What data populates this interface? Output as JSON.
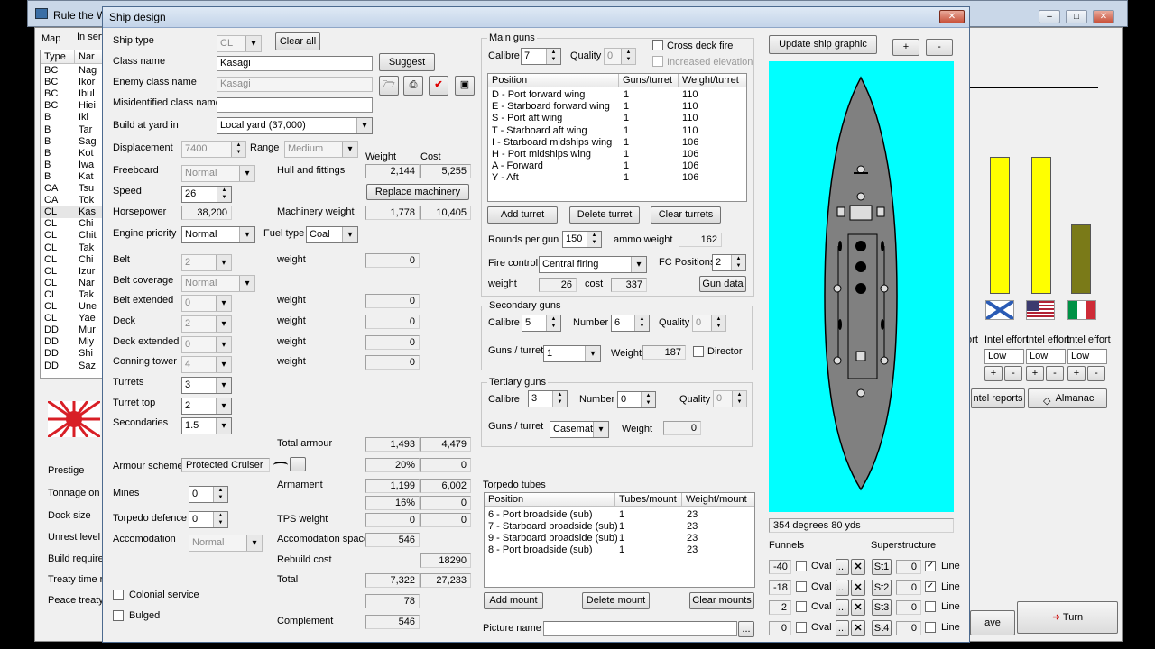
{
  "parent": {
    "title": "Rule the Wa",
    "tabs": [
      "Map",
      "In serv"
    ],
    "list_headers": [
      "Type",
      "Nar"
    ],
    "rows": [
      [
        "BC",
        "Nag"
      ],
      [
        "BC",
        "Ikor"
      ],
      [
        "BC",
        "Ibul"
      ],
      [
        "BC",
        "Hiei"
      ],
      [
        "B",
        "Iki"
      ],
      [
        "B",
        "Tar"
      ],
      [
        "B",
        "Sag"
      ],
      [
        "B",
        "Kot"
      ],
      [
        "B",
        "Iwa"
      ],
      [
        "B",
        "Kat"
      ],
      [
        "CA",
        "Tsu"
      ],
      [
        "CA",
        "Tok"
      ],
      [
        "CL",
        "Kas"
      ],
      [
        "CL",
        "Chi"
      ],
      [
        "CL",
        "Chit"
      ],
      [
        "CL",
        "Tak"
      ],
      [
        "CL",
        "Chi"
      ],
      [
        "CL",
        "Izur"
      ],
      [
        "CL",
        "Nar"
      ],
      [
        "CL",
        "Tak"
      ],
      [
        "CL",
        "Une"
      ],
      [
        "CL",
        "Yae"
      ],
      [
        "DD",
        "Mur"
      ],
      [
        "DD",
        "Miy"
      ],
      [
        "DD",
        "Shi"
      ],
      [
        "DD",
        "Saz"
      ]
    ],
    "left_labels": [
      "Prestige",
      "Tonnage on f",
      "Dock size",
      "Unrest level",
      "Build requiren",
      "Treaty time re",
      "Peace treaty l"
    ],
    "intel_labels": [
      "fort",
      "Intel effort",
      "Intel effort",
      "Intel effort"
    ],
    "intel_values": [
      "Low",
      "Low",
      "Low"
    ],
    "intel_reports": "ntel reports",
    "almanac": "Almanac",
    "save": "ave",
    "turn": "Turn"
  },
  "dialog": {
    "title": "Ship design",
    "ship_type_label": "Ship type",
    "ship_type": "CL",
    "clear_all": "Clear all",
    "class_name_label": "Class name",
    "class_name": "Kasagi",
    "suggest": "Suggest",
    "enemy_class_label": "Enemy class name",
    "enemy_class": "Kasagi",
    "misidentified_label": "Misidentified class name",
    "misidentified": "",
    "build_yard_label": "Build at yard in",
    "build_yard": "Local yard (37,000)",
    "displacement_label": "Displacement",
    "displacement": "7400",
    "range_label": "Range",
    "range": "Medium",
    "weight_hdr": "Weight",
    "cost_hdr": "Cost",
    "freeboard_label": "Freeboard",
    "freeboard": "Normal",
    "hull_label": "Hull and fittings",
    "hull_weight": "2,144",
    "hull_cost": "5,255",
    "speed_label": "Speed",
    "speed": "26",
    "replace_machinery": "Replace machinery",
    "horsepower_label": "Horsepower",
    "horsepower": "38,200",
    "machinery_label": "Machinery weight",
    "mach_weight": "1,778",
    "mach_cost": "10,405",
    "engine_label": "Engine priority",
    "engine": "Normal",
    "fuel_label": "Fuel type",
    "fuel": "Coal",
    "belt_label": "Belt",
    "belt": "2",
    "weight_lbl": "weight",
    "belt_weight": "0",
    "belt_cov_label": "Belt coverage",
    "belt_cov": "Normal",
    "belt_ext_label": "Belt extended",
    "belt_ext": "0",
    "belt_ext_weight": "0",
    "deck_label": "Deck",
    "deck": "2",
    "deck_weight": "0",
    "deck_ext_label": "Deck extended",
    "deck_ext": "0",
    "deck_ext_weight": "0",
    "conning_label": "Conning tower",
    "conning": "4",
    "conning_weight": "0",
    "turrets_label": "Turrets",
    "turrets": "3",
    "turret_top_label": "Turret top",
    "turret_top": "2",
    "secondaries_label": "Secondaries",
    "secondaries": "1.5",
    "total_armour_label": "Total armour",
    "total_armour_weight": "1,493",
    "total_armour_cost": "4,479",
    "armour_scheme_label": "Armour scheme",
    "armour_scheme": "Protected Cruiser",
    "armour_pct": "20%",
    "armour_pct_cost": "0",
    "armament_label": "Armament",
    "armament_weight": "1,199",
    "armament_cost": "6,002",
    "armament_pct": "16%",
    "armament_pct_cost": "0",
    "mines_label": "Mines",
    "mines": "0",
    "torp_def_label": "Torpedo defence",
    "torp_def": "0",
    "tps_label": "TPS weight",
    "tps_weight": "0",
    "tps_cost": "0",
    "accom_label": "Accomodation",
    "accom": "Normal",
    "accom_space_label": "Accomodation space",
    "accom_space": "546",
    "rebuild_label": "Rebuild cost",
    "rebuild": "18290",
    "total_label": "Total",
    "total_weight": "7,322",
    "total_cost": "27,233",
    "colonial_label": "Colonial service",
    "unknown_val": "78",
    "bulged_label": "Bulged",
    "complement_label": "Complement",
    "complement": "546",
    "main_guns": {
      "title": "Main guns",
      "calibre_label": "Calibre",
      "calibre": "7",
      "quality_label": "Quality",
      "quality": "0",
      "cross_deck": "Cross deck fire",
      "increased_elev": "Increased elevation",
      "headers": [
        "Position",
        "Guns/turret",
        "Weight/turret"
      ],
      "rows": [
        [
          "D - Port forward wing",
          "1",
          "110"
        ],
        [
          "E - Starboard forward wing",
          "1",
          "110"
        ],
        [
          "S - Port aft wing",
          "1",
          "110"
        ],
        [
          "T - Starboard aft wing",
          "1",
          "110"
        ],
        [
          "I - Starboard midships wing",
          "1",
          "106"
        ],
        [
          "H - Port midships wing",
          "1",
          "106"
        ],
        [
          "A - Forward",
          "1",
          "106"
        ],
        [
          "Y - Aft",
          "1",
          "106"
        ]
      ],
      "add_turret": "Add turret",
      "delete_turret": "Delete turret",
      "clear_turrets": "Clear turrets",
      "rounds_label": "Rounds per gun",
      "rounds": "150",
      "ammo_label": "ammo weight",
      "ammo": "162",
      "fire_control_label": "Fire control",
      "fire_control": "Central firing",
      "fc_positions_label": "FC Positions",
      "fc_positions": "2",
      "weight_label": "weight",
      "weight": "26",
      "cost_label": "cost",
      "cost": "337",
      "gun_data": "Gun data"
    },
    "secondary": {
      "title": "Secondary guns",
      "calibre_label": "Calibre",
      "calibre": "5",
      "number_label": "Number",
      "number": "6",
      "quality_label": "Quality",
      "quality": "0",
      "gpt_label": "Guns / turret",
      "gpt": "1",
      "weight_label": "Weight",
      "weight": "187",
      "director": "Director"
    },
    "tertiary": {
      "title": "Tertiary guns",
      "calibre_label": "Calibre",
      "calibre": "3",
      "number_label": "Number",
      "number": "0",
      "quality_label": "Quality",
      "quality": "0",
      "gpt_label": "Guns / turret",
      "gpt": "Casemate",
      "weight_label": "Weight",
      "weight": "0"
    },
    "torpedo": {
      "title": "Torpedo tubes",
      "headers": [
        "Position",
        "Tubes/mount",
        "Weight/mount"
      ],
      "rows": [
        [
          "6 - Port broadside (sub)",
          "1",
          "23"
        ],
        [
          "7 - Starboard broadside (sub)",
          "1",
          "23"
        ],
        [
          "9 - Starboard broadside (sub)",
          "1",
          "23"
        ],
        [
          "8 - Port broadside (sub)",
          "1",
          "23"
        ]
      ],
      "add_mount": "Add mount",
      "delete_mount": "Delete mount",
      "clear_mounts": "Clear mounts"
    },
    "picture_label": "Picture name",
    "picture": "",
    "browse": "...",
    "update_graphic": "Update ship graphic",
    "zoom_in": "+",
    "zoom_out": "-",
    "bearing": "354 degrees 80 yds",
    "funnels_label": "Funnels",
    "superstructure_label": "Superstructure",
    "funnels": [
      {
        "pos": "-40",
        "oval": "Oval",
        "st": "St1",
        "sv": "0",
        "line": true
      },
      {
        "pos": "-18",
        "oval": "Oval",
        "st": "St2",
        "sv": "0",
        "line": true
      },
      {
        "pos": "2",
        "oval": "Oval",
        "st": "St3",
        "sv": "0",
        "line": false
      },
      {
        "pos": "0",
        "oval": "Oval",
        "st": "St4",
        "sv": "0",
        "line": false
      }
    ],
    "line_label": "Line",
    "more": "..."
  }
}
